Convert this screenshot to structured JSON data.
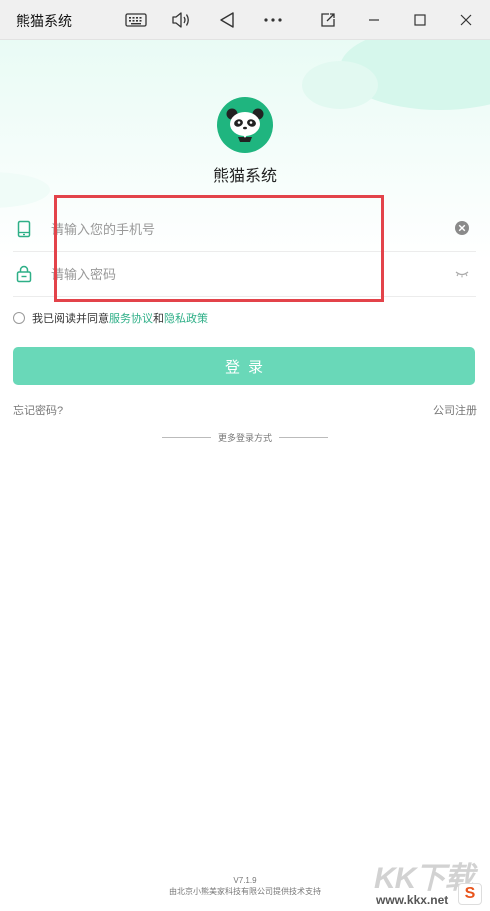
{
  "window": {
    "title": "熊猫系统"
  },
  "titlebar_icons": [
    "keyboard-icon",
    "volume-icon",
    "back-triangle-icon",
    "more-dots-icon",
    "screen-capture-icon",
    "minimize-icon",
    "maximize-icon",
    "close-icon"
  ],
  "app": {
    "name": "熊猫系统"
  },
  "login": {
    "phone_placeholder": "请输入您的手机号",
    "phone_value": "",
    "password_placeholder": "请输入密码",
    "password_value": "",
    "agree_prefix": "我已阅读并同意",
    "service_agreement": "服务协议",
    "and": "和",
    "privacy_policy": "隐私政策",
    "login_button": "登录",
    "forgot_password": "忘记密码?",
    "company_register": "公司注册",
    "more_login": "更多登录方式"
  },
  "footer": {
    "version": "V7.1.9",
    "support": "由北京小熊美家科技有限公司提供技术支持"
  },
  "watermark": {
    "text": "KK下载",
    "url": "www.kkx.net",
    "badge": "S"
  },
  "colors": {
    "accent": "#69d8b8",
    "link": "#2eaf87",
    "logo": "#1fb57f",
    "highlight": "#e3434a"
  }
}
